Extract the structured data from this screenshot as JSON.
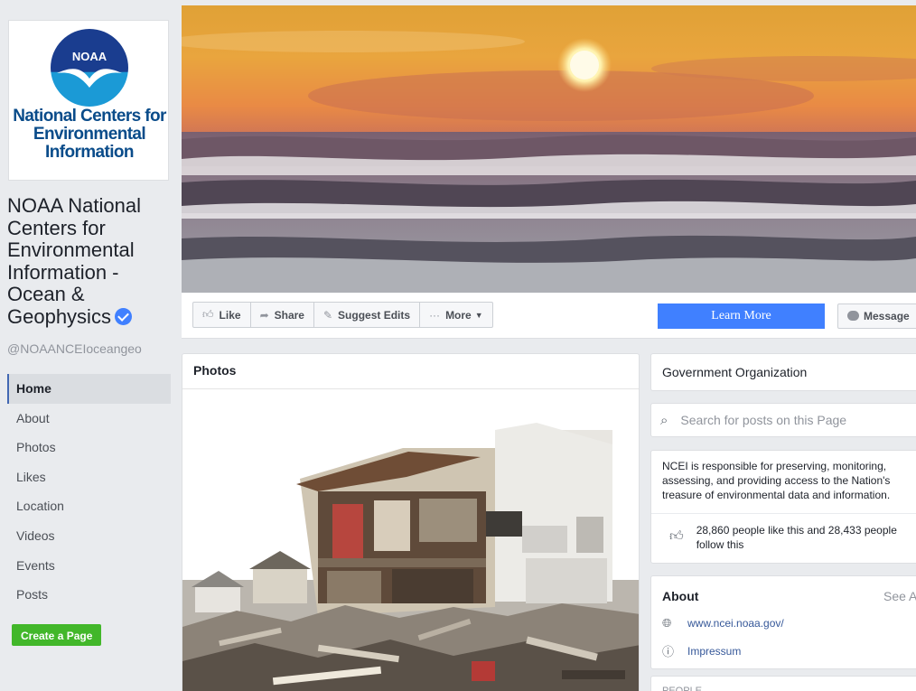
{
  "logo": {
    "emblem_text": "NOAA",
    "line1": "National Centers for",
    "line2": "Environmental",
    "line3": "Information"
  },
  "page": {
    "name": "NOAA National Centers for Environmental Information - Ocean & Geophysics",
    "handle": "@NOAANCEIoceangeo",
    "verified_icon": "verified-check-icon"
  },
  "nav": {
    "items": [
      {
        "label": "Home",
        "active": true
      },
      {
        "label": "About"
      },
      {
        "label": "Photos"
      },
      {
        "label": "Likes"
      },
      {
        "label": "Location"
      },
      {
        "label": "Videos"
      },
      {
        "label": "Events"
      },
      {
        "label": "Posts"
      }
    ],
    "create_page": "Create a Page"
  },
  "actions": {
    "like": "Like",
    "share": "Share",
    "suggest": "Suggest Edits",
    "more": "More",
    "learn_more": "Learn More",
    "message": "Message"
  },
  "photos": {
    "title": "Photos"
  },
  "sidebar": {
    "category": "Government Organization",
    "search_placeholder": "Search for posts on this Page",
    "description": "NCEI is responsible for preserving, monitoring, assessing, and providing access to the Nation's treasure of environmental data and information.",
    "stats": "28,860 people like this and 28,433 people follow this",
    "about_title": "About",
    "see_all": "See A",
    "website": "www.ncei.noaa.gov/",
    "impressum": "Impressum",
    "people_heading": "PEOPLE"
  },
  "colors": {
    "primary": "#4080ff",
    "green": "#42b72a",
    "link": "#365899",
    "noaa_blue": "#0a4c8a"
  }
}
